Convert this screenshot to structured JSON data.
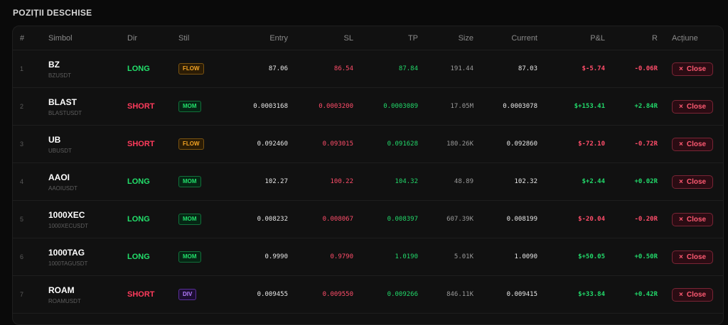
{
  "section_title": "POZIȚII DESCHISE",
  "columns": {
    "idx": "#",
    "symbol": "Simbol",
    "dir": "Dir",
    "style": "Stil",
    "entry": "Entry",
    "sl": "SL",
    "tp": "TP",
    "size": "Size",
    "current": "Current",
    "pnl": "P&L",
    "r": "R",
    "action": "Acțiune"
  },
  "close_label": "Close",
  "close_icon": "×",
  "rows": [
    {
      "idx": "1",
      "symbol": "BZ",
      "pair": "BZUSDT",
      "dir": "LONG",
      "style": "FLOW",
      "entry": "87.06",
      "sl": "86.54",
      "tp": "87.84",
      "size": "191.44",
      "current": "87.03",
      "pnl": "$-5.74",
      "r": "-0.06R"
    },
    {
      "idx": "2",
      "symbol": "BLAST",
      "pair": "BLASTUSDT",
      "dir": "SHORT",
      "style": "MOM",
      "entry": "0.0003168",
      "sl": "0.0003200",
      "tp": "0.0003089",
      "size": "17.05M",
      "current": "0.0003078",
      "pnl": "$+153.41",
      "r": "+2.84R"
    },
    {
      "idx": "3",
      "symbol": "UB",
      "pair": "UBUSDT",
      "dir": "SHORT",
      "style": "FLOW",
      "entry": "0.092460",
      "sl": "0.093015",
      "tp": "0.091628",
      "size": "180.26K",
      "current": "0.092860",
      "pnl": "$-72.10",
      "r": "-0.72R"
    },
    {
      "idx": "4",
      "symbol": "AAOI",
      "pair": "AAOIUSDT",
      "dir": "LONG",
      "style": "MOM",
      "entry": "102.27",
      "sl": "100.22",
      "tp": "104.32",
      "size": "48.89",
      "current": "102.32",
      "pnl": "$+2.44",
      "r": "+0.02R"
    },
    {
      "idx": "5",
      "symbol": "1000XEC",
      "pair": "1000XECUSDT",
      "dir": "LONG",
      "style": "MOM",
      "entry": "0.008232",
      "sl": "0.008067",
      "tp": "0.008397",
      "size": "607.39K",
      "current": "0.008199",
      "pnl": "$-20.04",
      "r": "-0.20R"
    },
    {
      "idx": "6",
      "symbol": "1000TAG",
      "pair": "1000TAGUSDT",
      "dir": "LONG",
      "style": "MOM",
      "entry": "0.9990",
      "sl": "0.9790",
      "tp": "1.0190",
      "size": "5.01K",
      "current": "1.0090",
      "pnl": "$+50.05",
      "r": "+0.50R"
    },
    {
      "idx": "7",
      "symbol": "ROAM",
      "pair": "ROAMUSDT",
      "dir": "SHORT",
      "style": "DIV",
      "entry": "0.009455",
      "sl": "0.009550",
      "tp": "0.009266",
      "size": "846.11K",
      "current": "0.009415",
      "pnl": "$+33.84",
      "r": "+0.42R"
    }
  ],
  "colors": {
    "long": "#22e06b",
    "short": "#ff3b5c",
    "loss": "#ff4d6a",
    "gain": "#22d86a",
    "flow": "#f5a524",
    "mom": "#22e06b",
    "div": "#b57bff"
  }
}
